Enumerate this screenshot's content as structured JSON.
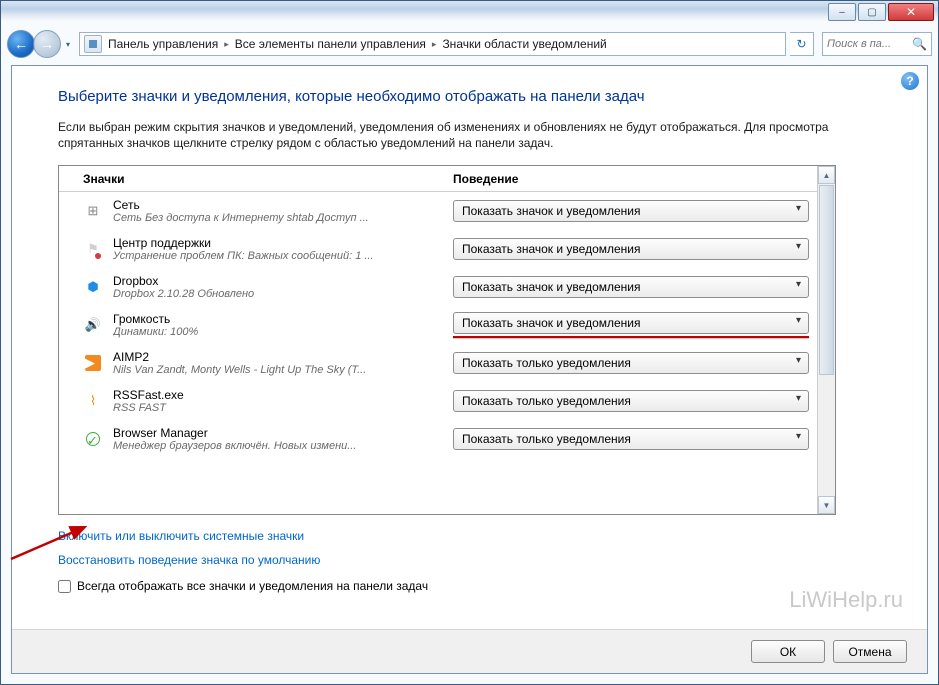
{
  "titlebar": {
    "min": "–",
    "max": "▢",
    "close": "✕"
  },
  "nav": {
    "back": "←",
    "fwd": "→",
    "drop": "▾",
    "refresh": "↻"
  },
  "breadcrumb": {
    "items": [
      "Панель управления",
      "Все элементы панели управления",
      "Значки области уведомлений"
    ]
  },
  "search": {
    "placeholder": "Поиск в па..."
  },
  "help": "?",
  "heading": "Выберите значки и уведомления, которые необходимо отображать на панели задач",
  "description": "Если выбран режим скрытия значков и уведомлений, уведомления об изменениях и обновлениях не будут отображаться. Для просмотра спрятанных значков щелкните стрелку рядом с областью уведомлений на панели задач.",
  "columns": {
    "c1": "Значки",
    "c2": "Поведение"
  },
  "options": {
    "show_icon_notify": "Показать значок и уведомления",
    "show_notify_only": "Показать только уведомления"
  },
  "rows": [
    {
      "icon": "net",
      "name": "Сеть",
      "sub": "Сеть Без доступа к Интернету shtab Доступ ...",
      "val": "show_icon_notify",
      "hl": false
    },
    {
      "icon": "flag",
      "name": "Центр поддержки",
      "sub": "Устранение проблем ПК: Важных сообщений: 1 ...",
      "val": "show_icon_notify",
      "hl": false
    },
    {
      "icon": "dbx",
      "name": "Dropbox",
      "sub": "Dropbox 2.10.28 Обновлено",
      "val": "show_icon_notify",
      "hl": false
    },
    {
      "icon": "vol",
      "name": "Громкость",
      "sub": "Динамики: 100%",
      "val": "show_icon_notify",
      "hl": true
    },
    {
      "icon": "aimp",
      "name": "AIMP2",
      "sub": "Nils Van Zandt, Monty Wells - Light Up The Sky (T...",
      "val": "show_notify_only",
      "hl": false
    },
    {
      "icon": "rss",
      "name": "RSSFast.exe",
      "sub": "RSS FAST",
      "val": "show_notify_only",
      "hl": false
    },
    {
      "icon": "bm",
      "name": "Browser Manager",
      "sub": "Менеджер браузеров включён. Новых измени...",
      "val": "show_notify_only",
      "hl": false
    }
  ],
  "link1": "Включить или выключить системные значки",
  "link2": "Восстановить поведение значка по умолчанию",
  "checkbox": "Всегда отображать все значки и уведомления на панели задач",
  "buttons": {
    "ok": "ОК",
    "cancel": "Отмена"
  },
  "watermark": "LiWiHelp.ru",
  "scroll": {
    "up": "▲",
    "down": "▼"
  }
}
